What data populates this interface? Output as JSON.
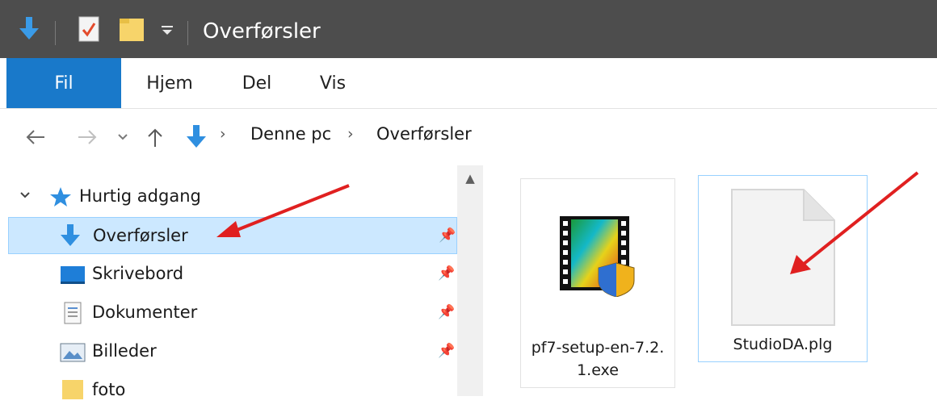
{
  "window": {
    "title": "Overførsler"
  },
  "ribbon": {
    "tabs": [
      "Fil",
      "Hjem",
      "Del",
      "Vis"
    ]
  },
  "address": {
    "crumbs": [
      "Denne pc",
      "Overførsler"
    ]
  },
  "navpane": {
    "items": [
      {
        "label": "Hurtig adgang",
        "icon": "pin-star-icon"
      },
      {
        "label": "Overførsler",
        "icon": "download-arrow-icon",
        "selected": true,
        "pinned": true
      },
      {
        "label": "Skrivebord",
        "icon": "desktop-icon",
        "pinned": true
      },
      {
        "label": "Dokumenter",
        "icon": "documents-icon",
        "pinned": true
      },
      {
        "label": "Billeder",
        "icon": "pictures-icon",
        "pinned": true
      },
      {
        "label": "foto",
        "icon": "folder-icon"
      }
    ]
  },
  "files": [
    {
      "name_line1": "pf7-setup-en-7.2.",
      "name_line2": "1.exe",
      "icon": "installer-film-icon"
    },
    {
      "name": "StudioDA.plg",
      "icon": "blank-file-icon",
      "selected": true
    }
  ],
  "colors": {
    "titlebar": "#4d4d4d",
    "accent": "#1979ca",
    "selection": "#cce8ff",
    "annotation_arrow": "#e02020"
  }
}
